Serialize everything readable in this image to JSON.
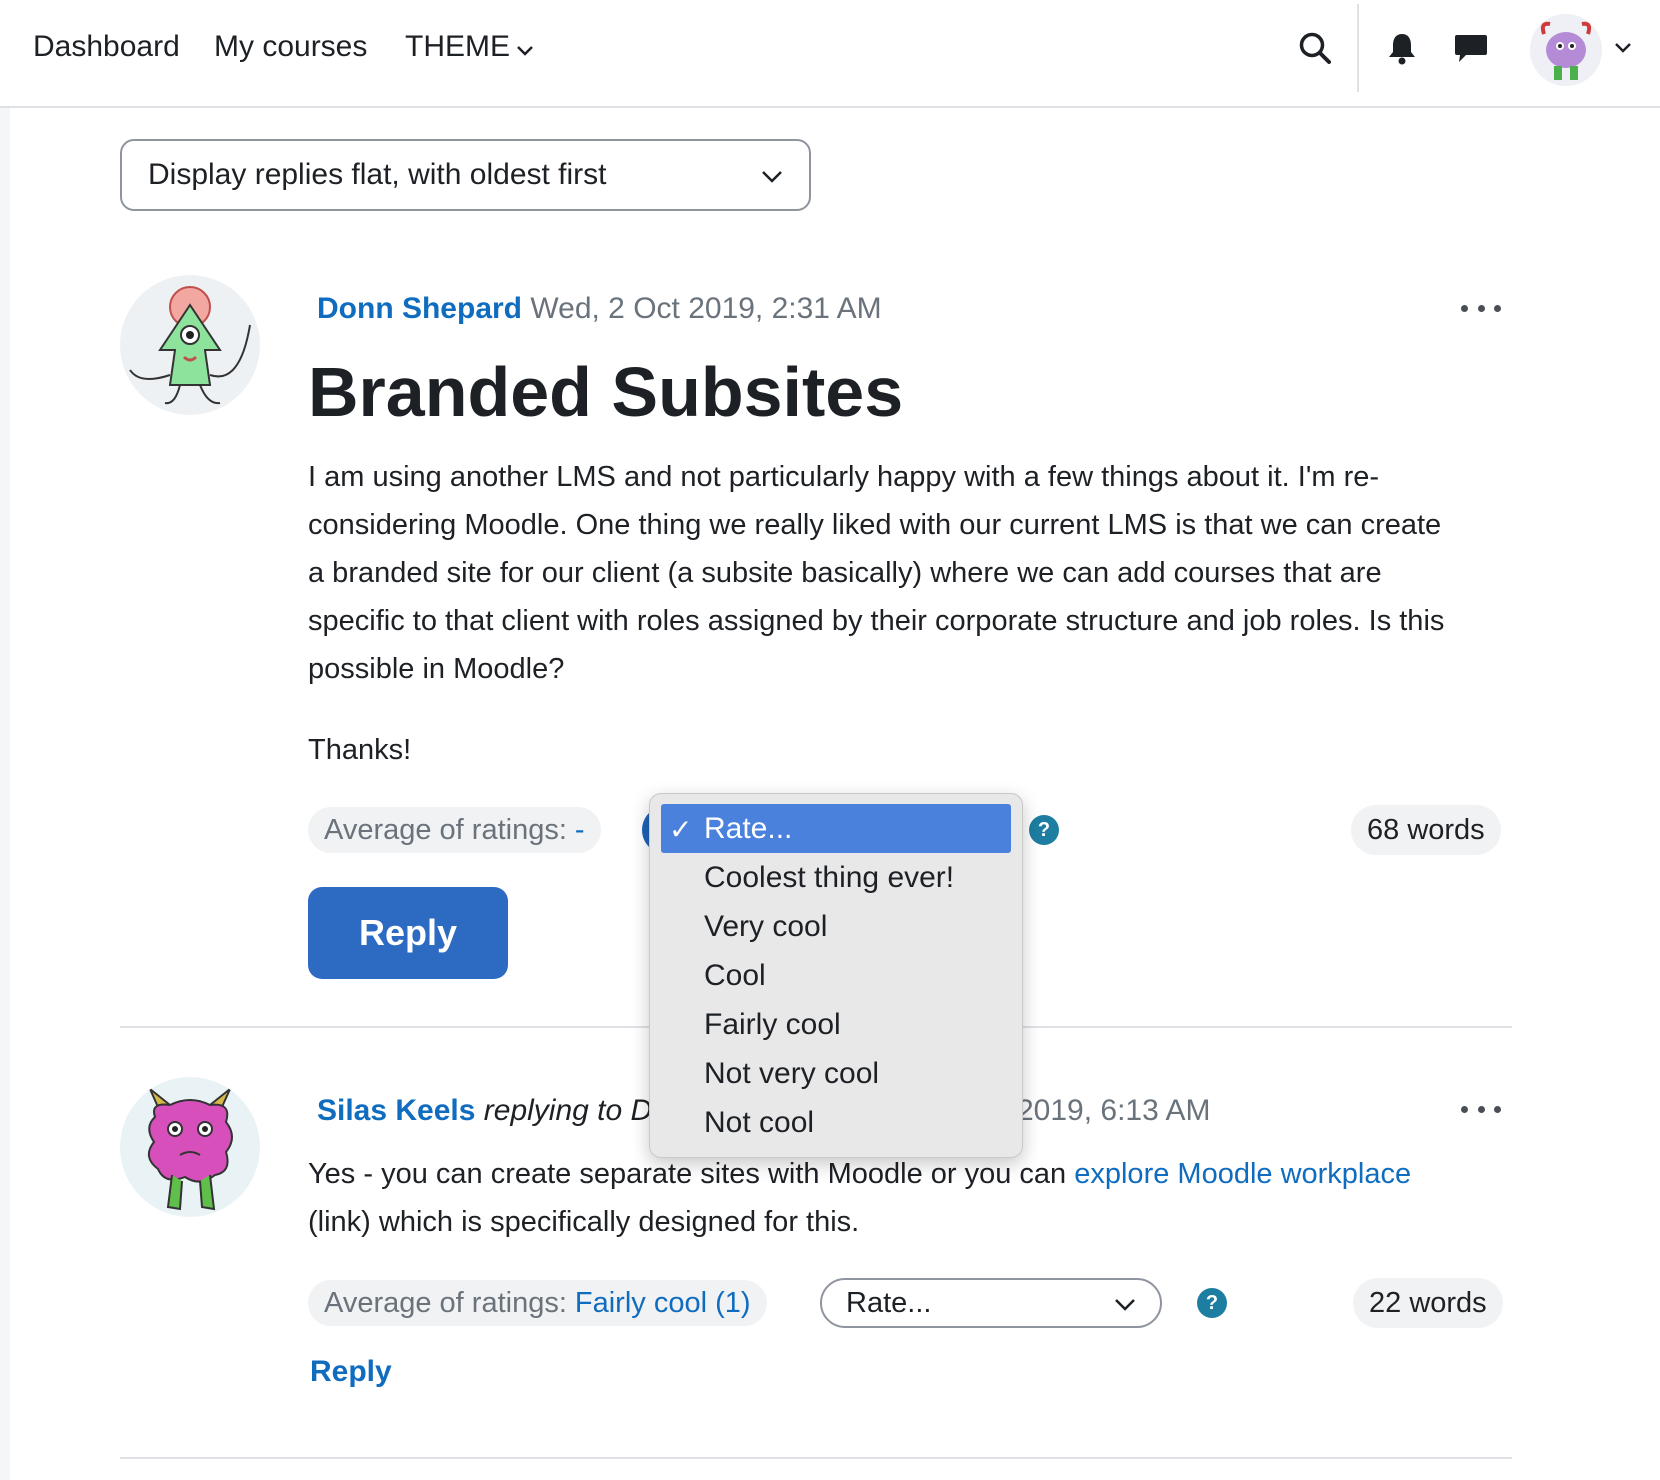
{
  "nav": {
    "dashboard": "Dashboard",
    "my_courses": "My courses",
    "theme": "THEME"
  },
  "display_mode": {
    "selected": "Display replies flat, with oldest first"
  },
  "posts": [
    {
      "author": "Donn Shepard",
      "date": "Wed, 2 Oct 2019, 2:31 AM",
      "title": "Branded Subsites",
      "body": "I am using another LMS and not particularly happy with a few things about it.  I'm re-considering Moodle.  One thing we really liked with our current LMS is that we can create a branded site for our client (a subsite basically) where we can add courses that are specific to that client with roles assigned by their corporate structure and job roles.   Is this possible in Moodle?",
      "thanks": "Thanks!",
      "avg_label": "Average of ratings:",
      "avg_value": "-",
      "words": "68 words",
      "reply": "Reply"
    },
    {
      "author": "Silas Keels",
      "replying": "replying to D",
      "date_tail": "2019, 6:13 AM",
      "body_before": "Yes - you can create separate sites with Moodle or you can ",
      "link_text": "explore Moodle workplace",
      "body_after": " (link) which is specifically designed for this.",
      "avg_label": "Average of ratings:",
      "avg_value": "Fairly cool (1)",
      "rate_selected": "Rate...",
      "words": "22 words",
      "reply": "Reply"
    }
  ],
  "help_glyph": "?",
  "check_glyph": "✓",
  "rating_options": [
    "Rate...",
    "Coolest thing ever!",
    "Very cool",
    "Cool",
    "Fairly cool",
    "Not very cool",
    "Not cool"
  ],
  "colors": {
    "link": "#0f6cbf",
    "primary_button": "#2d6bc2",
    "help_icon": "#1e7ea1",
    "dropdown_selected": "#4a81dc"
  }
}
